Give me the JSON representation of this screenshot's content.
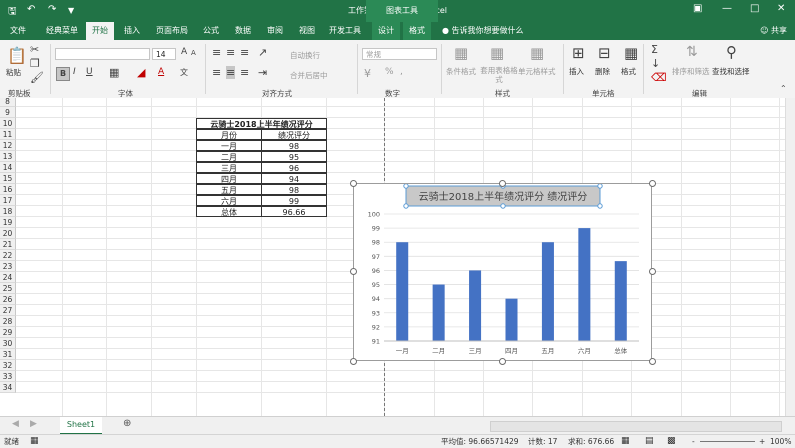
{
  "title_bar": {
    "title": "工作簿4 [兼容模式] - Excel",
    "context_label": "图表工具",
    "window_controls": [
      "restore-icon",
      "minimize-icon",
      "maximize-icon",
      "close-icon"
    ]
  },
  "tabs": [
    "文件",
    "经典菜单",
    "开始",
    "插入",
    "页面布局",
    "公式",
    "数据",
    "审阅",
    "视图",
    "开发工具",
    "设计",
    "格式"
  ],
  "active_tab": "开始",
  "tell_me": "告诉我你想要做什么",
  "share": "共享",
  "ribbon": {
    "clipboard": {
      "paste": "粘贴",
      "label": "剪贴板"
    },
    "font": {
      "font_name": "",
      "font_size": "14",
      "label": "字体",
      "bold": "B",
      "italic": "I",
      "underline": "U",
      "grow": "A",
      "shrink": "A",
      "color_a": "A",
      "wen": "文"
    },
    "alignment": {
      "wrap": "自动换行",
      "merge": "合并后居中",
      "label": "对齐方式"
    },
    "number": {
      "format": "常规",
      "label": "数字",
      "percent": "%",
      "comma": ","
    },
    "styles": {
      "conditional": "条件格式",
      "table": "套用表格格式",
      "cell": "单元格样式",
      "label": "样式"
    },
    "cells": {
      "insert": "插入",
      "delete": "删除",
      "format": "格式",
      "label": "单元格"
    },
    "editing": {
      "sort": "排序和筛选",
      "find": "查找和选择",
      "label": "编辑"
    }
  },
  "rows": [
    "8",
    "9",
    "10",
    "11",
    "12",
    "13",
    "14",
    "15",
    "16",
    "17",
    "18",
    "19",
    "20",
    "21",
    "22",
    "23",
    "24",
    "25",
    "26",
    "27",
    "28",
    "29",
    "30",
    "31",
    "32",
    "33",
    "34"
  ],
  "table": {
    "title": "云骑士2018上半年绩况评分",
    "headers": [
      "月份",
      "绩况评分"
    ],
    "rows": [
      [
        "一月",
        "98"
      ],
      [
        "二月",
        "95"
      ],
      [
        "三月",
        "96"
      ],
      [
        "四月",
        "94"
      ],
      [
        "五月",
        "98"
      ],
      [
        "六月",
        "99"
      ],
      [
        "总体",
        "96.66"
      ]
    ]
  },
  "chart_data": {
    "type": "bar",
    "title": "云骑士2018上半年绩况评分 绩况评分",
    "categories": [
      "一月",
      "二月",
      "三月",
      "四月",
      "五月",
      "六月",
      "总体"
    ],
    "values": [
      98,
      95,
      96,
      94,
      98,
      99,
      96.66
    ],
    "ylim": [
      91,
      100
    ],
    "yticks": [
      "91",
      "92",
      "93",
      "94",
      "95",
      "96",
      "97",
      "98",
      "99",
      "100"
    ],
    "bar_color": "#4472C4",
    "grid": true,
    "legend": "none"
  },
  "sheet_tab": "Sheet1",
  "status": {
    "mode": "就绪",
    "average": "平均值: 96.66571429",
    "count": "计数: 17",
    "sum": "求和: 676.66",
    "zoom": "100%"
  },
  "colors": {
    "excel_green": "#217346",
    "bar": "#4472C4"
  }
}
